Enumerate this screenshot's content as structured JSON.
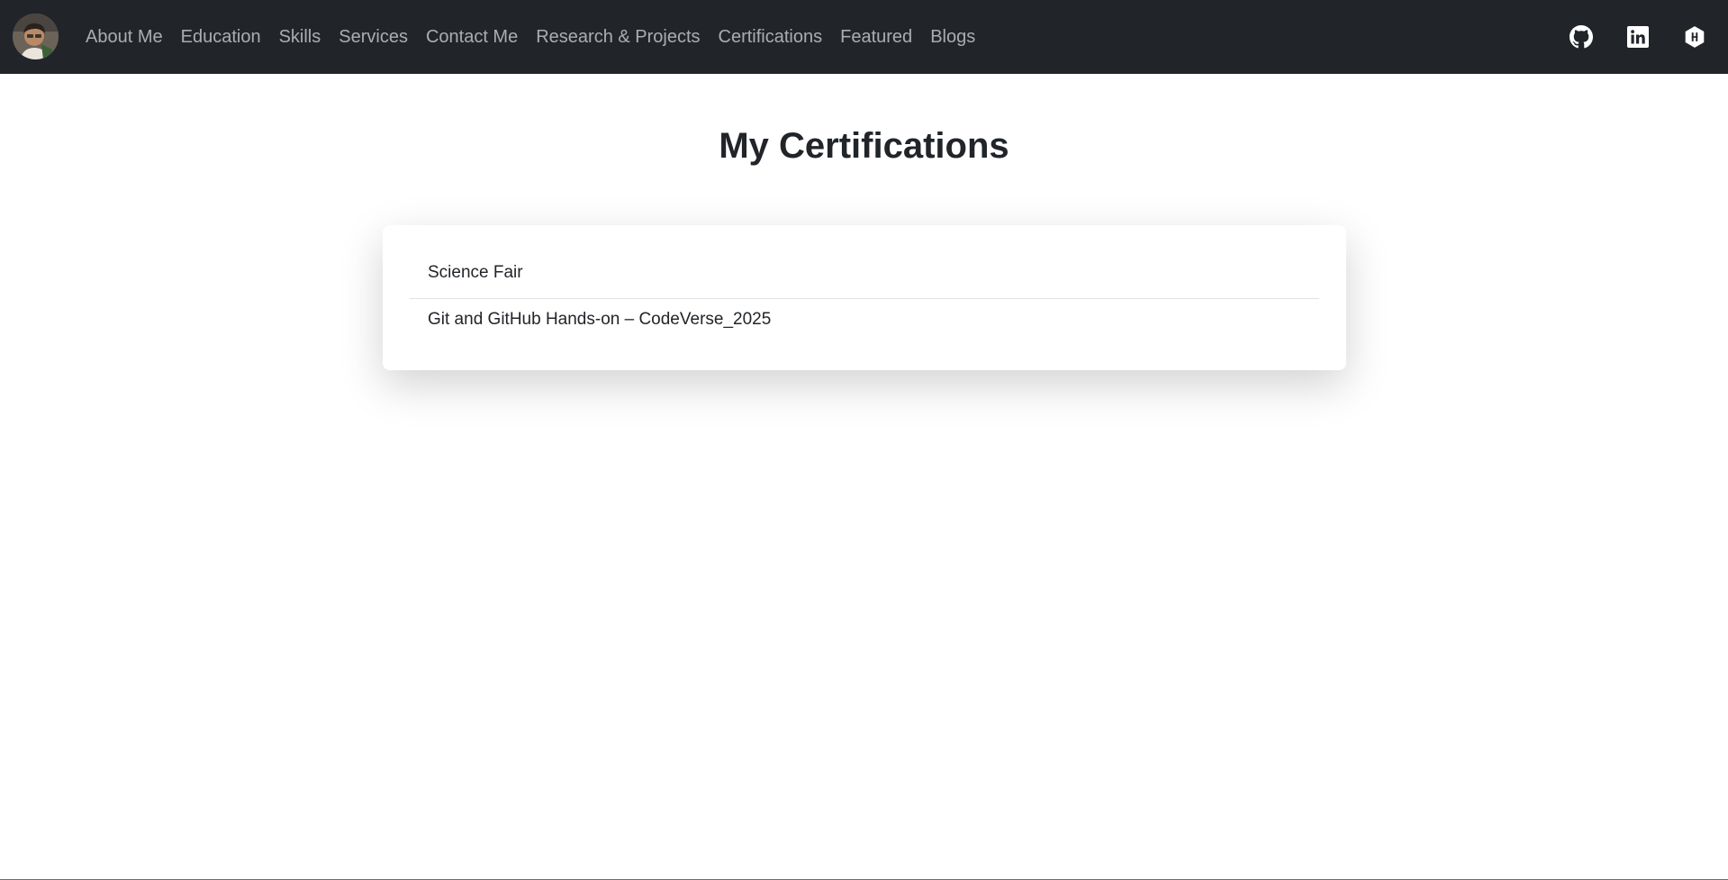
{
  "nav": {
    "avatar_alt": "profile photo",
    "links": [
      {
        "label": "About Me"
      },
      {
        "label": "Education"
      },
      {
        "label": "Skills"
      },
      {
        "label": "Services"
      },
      {
        "label": "Contact Me"
      },
      {
        "label": "Research & Projects"
      },
      {
        "label": "Certifications"
      },
      {
        "label": "Featured"
      },
      {
        "label": "Blogs"
      }
    ],
    "social_icons": [
      "github-icon",
      "linkedin-icon",
      "hashnode-icon"
    ]
  },
  "main": {
    "title": "My Certifications",
    "certifications": [
      {
        "label": "Science Fair"
      },
      {
        "label": "Git and GitHub Hands-on – CodeVerse_2025"
      }
    ]
  },
  "colors": {
    "navbar_bg": "#212529",
    "nav_text": "#a6a8aa",
    "page_bg": "#ffffff",
    "text": "#212529"
  }
}
